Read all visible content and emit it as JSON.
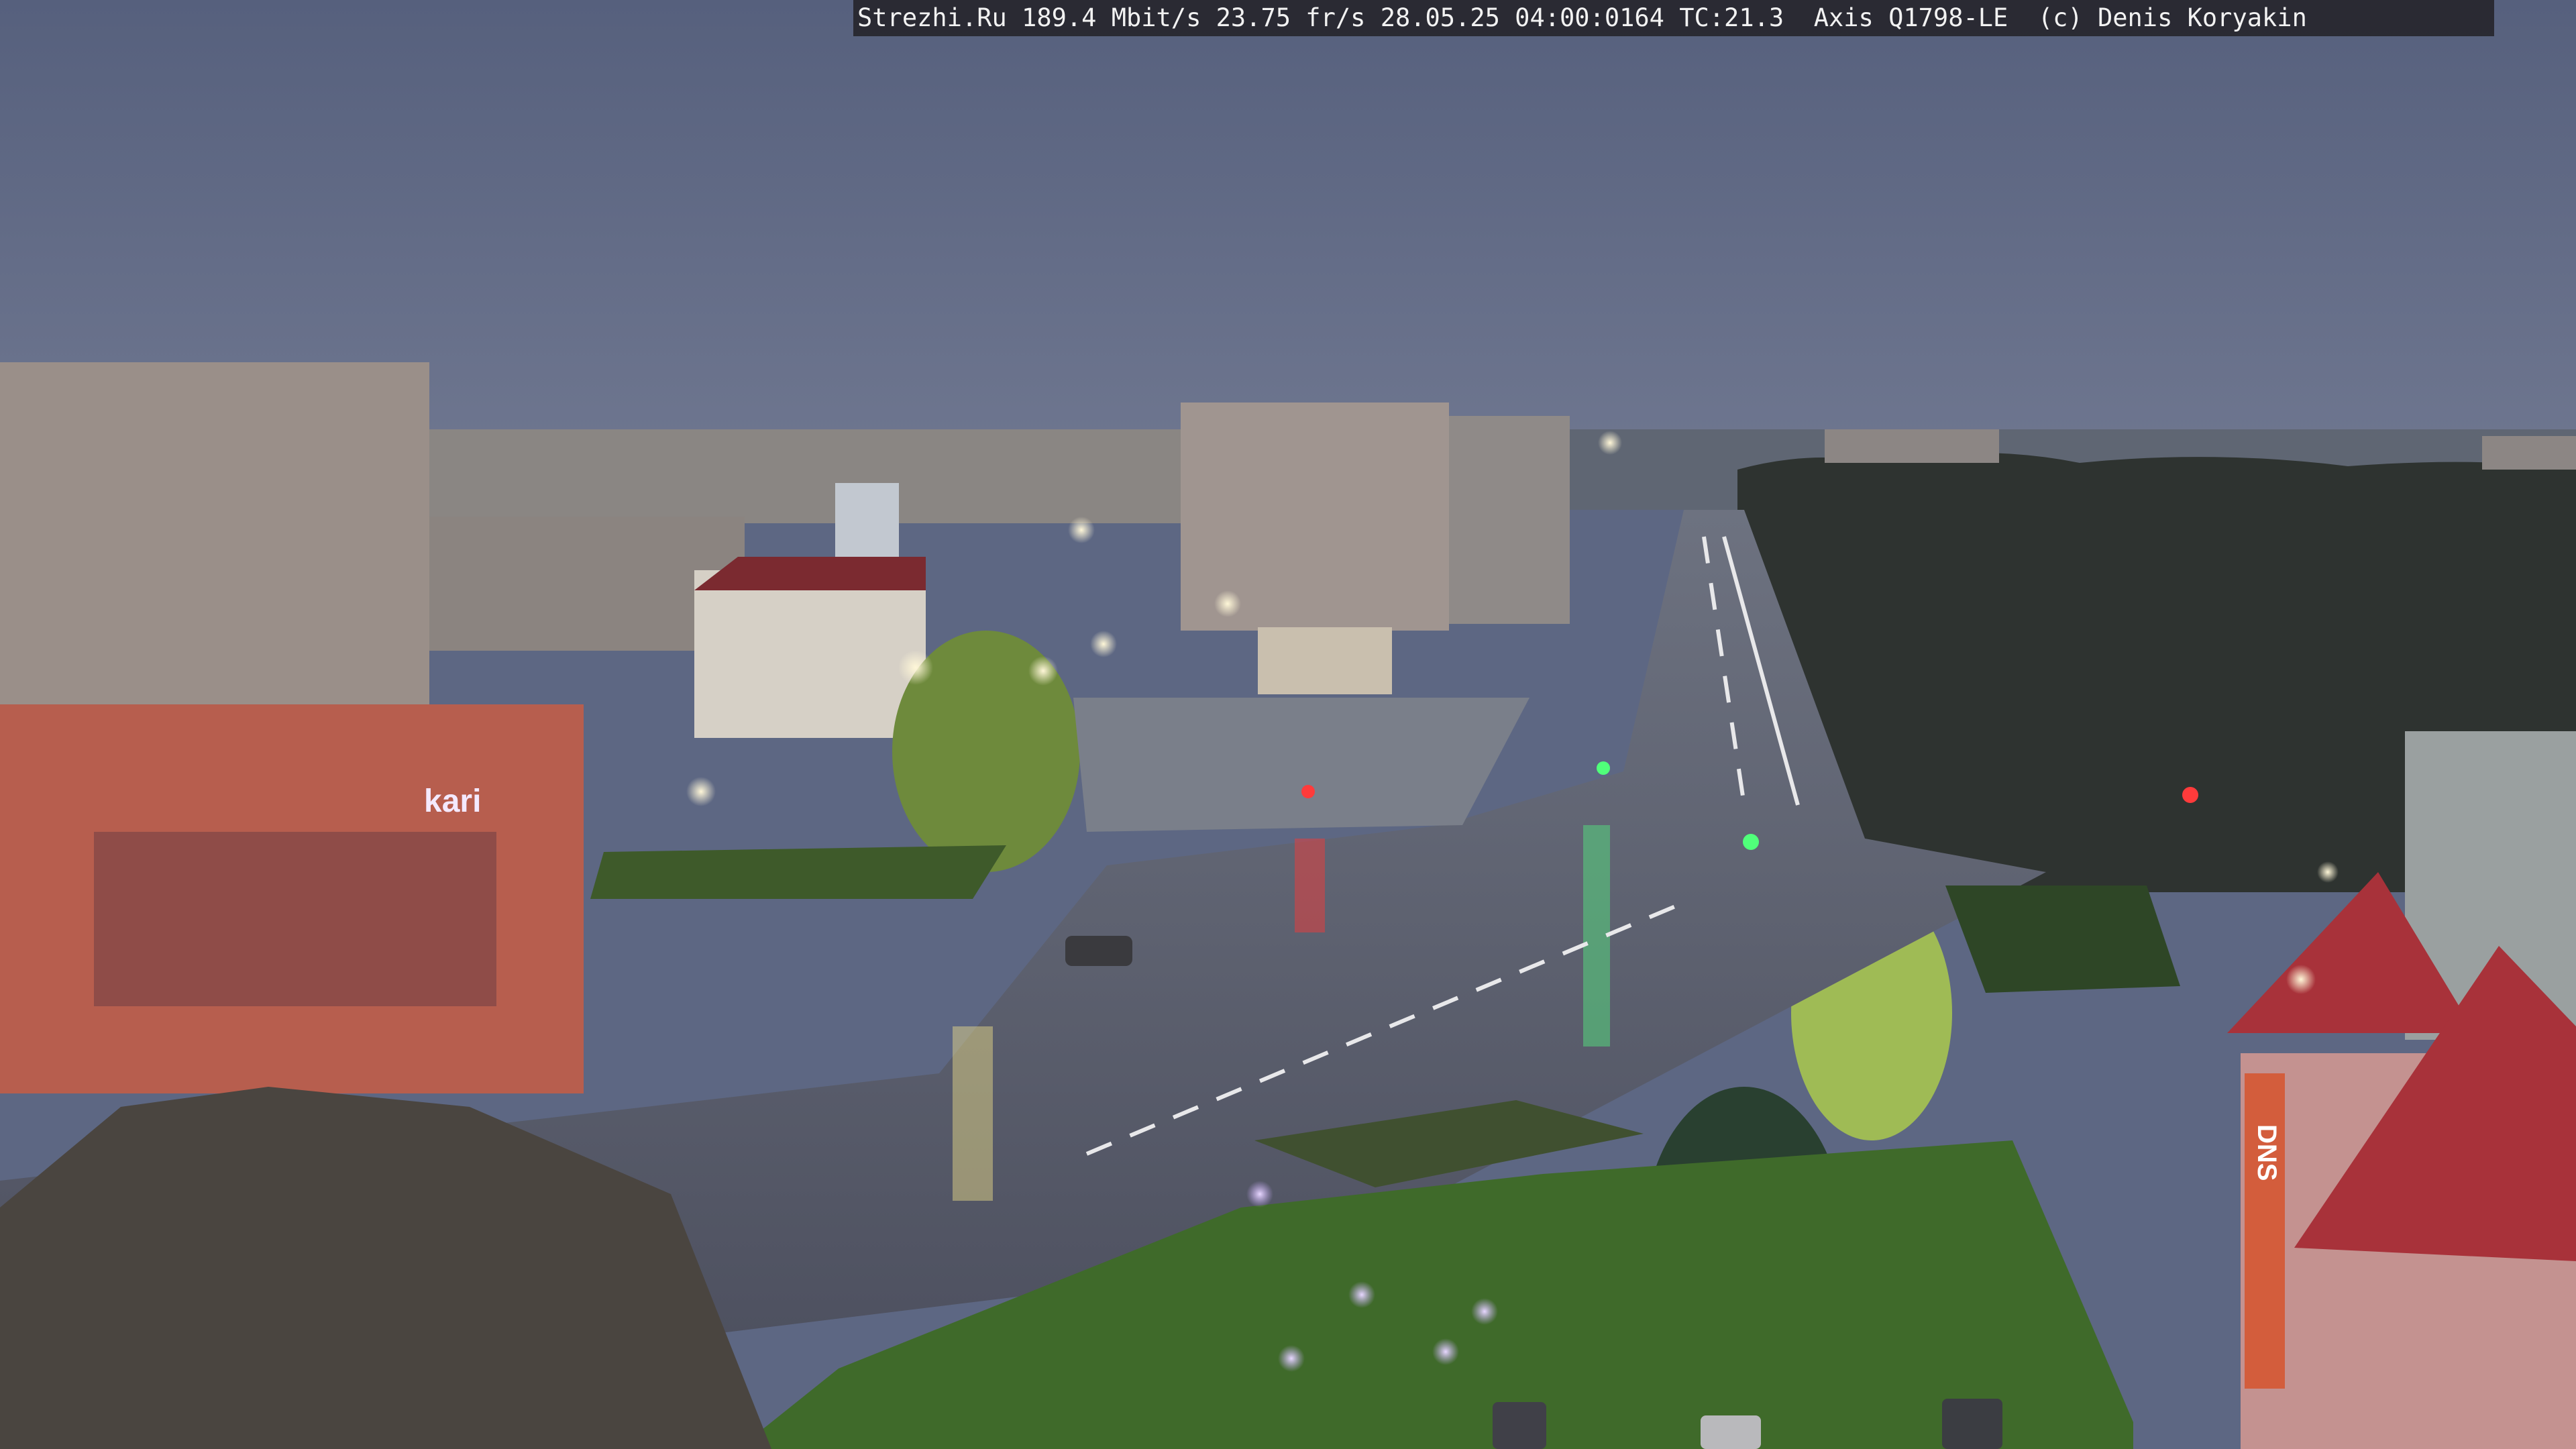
{
  "overlay": {
    "site": "Strezhi.Ru",
    "bitrate": "189.4 Mbit/s",
    "framerate": "23.75 fr/s",
    "datetime": "28.05.25 04:00:0164",
    "tc": "TC:21.3",
    "camera": "Axis Q1798-LE",
    "copyright": "(c) Denis Koryakin"
  },
  "signs": {
    "kari": "kari",
    "dns": "DNS"
  },
  "colors": {
    "sky": "#5d6783",
    "overlay_bg": "#26262c",
    "overlay_text": "#f2f2f2"
  }
}
